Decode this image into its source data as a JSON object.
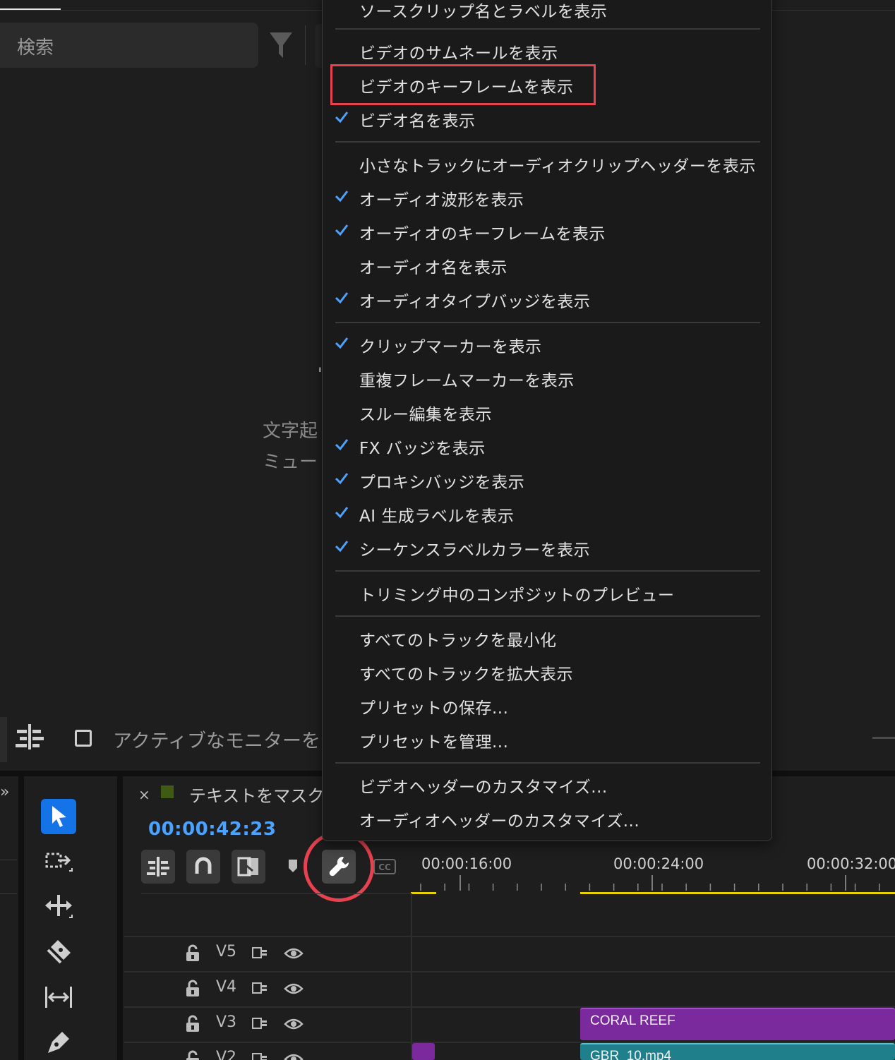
{
  "upper_panel": {
    "search_placeholder": "検索",
    "hint_line1": "文字起",
    "hint_line2": "ミュー",
    "hint_glyph": "'",
    "active_monitor_label": "アクティブなモニターを"
  },
  "timeline": {
    "sequence_title": "テキストをマスク",
    "timecode": "00:00:42:23",
    "ruler_labels": [
      "00:00:16:00",
      "00:00:24:00",
      "00:00:32:00"
    ],
    "tracks": [
      {
        "name": "V5"
      },
      {
        "name": "V4"
      },
      {
        "name": "V3"
      },
      {
        "name": "V2"
      }
    ],
    "clips": {
      "coral": "CORAL REEF",
      "gbr": "GBR_10.mp4"
    },
    "colors": {
      "timecode": "#4ba3ff",
      "clip_purple": "#7b2a9e",
      "clip_teal": "#1f7f8a",
      "work_area": "#e6d200",
      "highlight": "#e8414f",
      "accent_blue": "#1473e6"
    }
  },
  "tools": [
    "selection-tool",
    "track-select-tool",
    "ripple-edit-tool",
    "razor-tool",
    "slip-tool",
    "pen-tool"
  ],
  "menu": {
    "items": [
      {
        "label": "ソースクリップ名とラベルを表示",
        "checked": false
      },
      {
        "label": "ビデオのサムネールを表示",
        "checked": false
      },
      {
        "label": "ビデオのキーフレームを表示",
        "checked": false,
        "highlighted": true
      },
      {
        "label": "ビデオ名を表示",
        "checked": true
      },
      {
        "label": "小さなトラックにオーディオクリップヘッダーを表示",
        "checked": false
      },
      {
        "label": "オーディオ波形を表示",
        "checked": true
      },
      {
        "label": "オーディオのキーフレームを表示",
        "checked": true
      },
      {
        "label": "オーディオ名を表示",
        "checked": false
      },
      {
        "label": "オーディオタイプバッジを表示",
        "checked": true
      },
      {
        "label": "クリップマーカーを表示",
        "checked": true
      },
      {
        "label": "重複フレームマーカーを表示",
        "checked": false
      },
      {
        "label": "スルー編集を表示",
        "checked": false
      },
      {
        "label": "FX バッジを表示",
        "checked": true
      },
      {
        "label": "プロキシバッジを表示",
        "checked": true
      },
      {
        "label": "AI 生成ラベルを表示",
        "checked": true
      },
      {
        "label": "シーケンスラベルカラーを表示",
        "checked": true
      },
      {
        "label": "トリミング中のコンポジットのプレビュー",
        "checked": false
      },
      {
        "label": "すべてのトラックを最小化",
        "checked": false
      },
      {
        "label": "すべてのトラックを拡大表示",
        "checked": false
      },
      {
        "label": "プリセットの保存...",
        "checked": false
      },
      {
        "label": "プリセットを管理...",
        "checked": false
      },
      {
        "label": "ビデオヘッダーのカスタマイズ...",
        "checked": false
      },
      {
        "label": "オーディオヘッダーのカスタマイズ...",
        "checked": false
      }
    ]
  }
}
